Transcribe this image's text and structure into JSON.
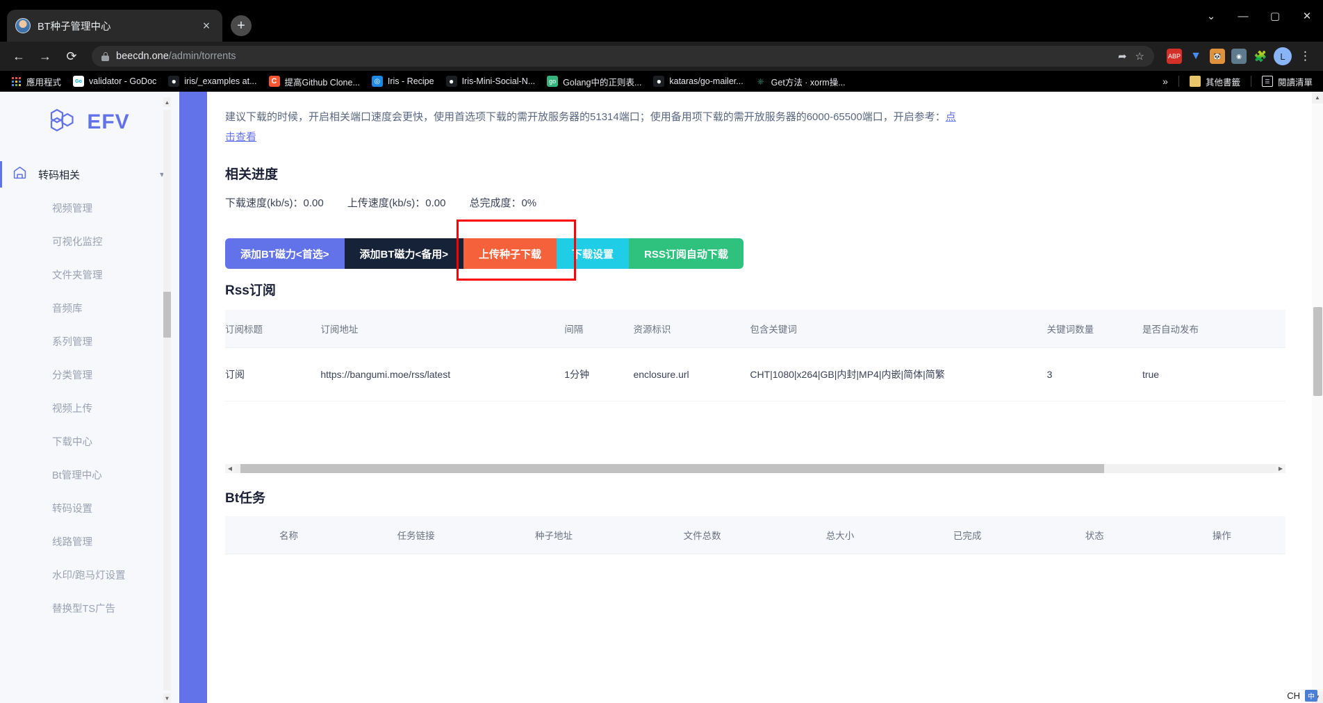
{
  "browser": {
    "tab": {
      "title": "BT种子管理中心",
      "favicon": "user-avatar-favicon",
      "close": "×"
    },
    "new_tab": "+",
    "window_controls": {
      "minimize_all": "⌄",
      "minimize": "—",
      "maximize": "▢",
      "close": "✕"
    },
    "nav": {
      "back": "←",
      "forward": "→",
      "reload": "⟳"
    },
    "omnibox": {
      "domain": "beecdn.one",
      "path": "/admin/torrents",
      "share_icon": "share-icon",
      "bookmark_icon": "star-icon"
    },
    "extensions": [
      {
        "name": "adblock-plus",
        "label": "ABP",
        "color": "#d4302a"
      },
      {
        "name": "vue-devtools",
        "label": "V",
        "color": "#41b883"
      },
      {
        "name": "tampermonkey",
        "label": "TM",
        "color": "#e0913b"
      },
      {
        "name": "proxy-switchy",
        "label": "P",
        "color": "#5e7a8c"
      },
      {
        "name": "puzzle-extensions",
        "label": "🧩",
        "color": "#3c4043"
      }
    ],
    "profile": "L",
    "menu": "⋮",
    "bookmarks": [
      {
        "label": "應用程式",
        "icon": "apps-grid-icon",
        "color": ""
      },
      {
        "label": "validator - GoDoc",
        "icon": "godoc-icon",
        "color": "#ffffff"
      },
      {
        "label": "iris/_examples at...",
        "icon": "github-icon",
        "color": "#1b1f23"
      },
      {
        "label": "提高Github Clone...",
        "icon": "csdn-icon",
        "color": "#fc5531"
      },
      {
        "label": "Iris - Recipe",
        "icon": "iris-icon",
        "color": "#1e88e5"
      },
      {
        "label": "Iris-Mini-Social-N...",
        "icon": "github-icon",
        "color": "#1b1f23"
      },
      {
        "label": "Golang中的正则表...",
        "icon": "go-icon",
        "color": "#35b37e"
      },
      {
        "label": "kataras/go-mailer...",
        "icon": "github-icon",
        "color": "#1b1f23"
      },
      {
        "label": "Get方法 · xorm操...",
        "icon": "gitbook-icon",
        "color": "#3b8070"
      }
    ],
    "bookmarks_overflow": "»",
    "other_bookmarks": {
      "label": "其他書籤",
      "icon": "folder-icon"
    },
    "reading_list": {
      "label": "閱讀清單",
      "icon": "reading-list-icon"
    }
  },
  "sidebar": {
    "brand": {
      "text": "EFV",
      "logo": "hexagon-logo-icon"
    },
    "group": {
      "label": "转码相关",
      "icon": "home-icon",
      "chevron": "chevron-down-icon"
    },
    "items": [
      {
        "label": "视频管理"
      },
      {
        "label": "可视化监控"
      },
      {
        "label": "文件夹管理"
      },
      {
        "label": "音频库"
      },
      {
        "label": "系列管理"
      },
      {
        "label": "分类管理"
      },
      {
        "label": "视频上传"
      },
      {
        "label": "下载中心"
      },
      {
        "label": "Bt管理中心"
      },
      {
        "label": "转码设置"
      },
      {
        "label": "线路管理"
      },
      {
        "label": "水印/跑马灯设置"
      },
      {
        "label": "替换型TS广告"
      }
    ]
  },
  "main": {
    "notice_line1": "建议下载的时候，开启相关端口速度会更快，使用首选项下载的需开放服务器的51314端口；使用备用项下载的需开放服务器的6000-65500端口，开启参考：",
    "notice_link1": "点",
    "notice_link2": "击查看",
    "progress_title": "相关进度",
    "progress": {
      "download_speed_label": "下载速度(kb/s)：",
      "download_speed_value": "0.00",
      "upload_speed_label": "上传速度(kb/s)：",
      "upload_speed_value": "0.00",
      "total_label": "总完成度：",
      "total_value": "0%"
    },
    "buttons": [
      {
        "label": "添加BT磁力<首选>",
        "color": "#6272e8",
        "name": "add-bt-magnet-primary-button"
      },
      {
        "label": "添加BT磁力<备用>",
        "color": "#152238",
        "name": "add-bt-magnet-backup-button"
      },
      {
        "label": "上传种子下载",
        "color": "#f4613a",
        "name": "upload-torrent-download-button"
      },
      {
        "label": "下载设置",
        "color": "#1fcde6",
        "name": "download-settings-button"
      },
      {
        "label": "RSS订阅自动下载",
        "color": "#2ec27e",
        "name": "rss-auto-download-button"
      }
    ],
    "highlight_color": "#ff0000",
    "rss_section_title": "Rss订阅",
    "rss_table": {
      "headers": [
        "订阅标题",
        "订阅地址",
        "间隔",
        "资源标识",
        "包含关键词",
        "关键词数量",
        "是否自动发布",
        ""
      ],
      "rows": [
        {
          "title": "订阅",
          "url": "https://bangumi.moe/rss/latest",
          "interval": "1分钟",
          "resource_id": "enclosure.url",
          "keywords": "CHT|1080|x264|GB|内封|MP4|内嵌|简体|简繁",
          "keyword_count": "3",
          "auto_publish": "true",
          "extra": ""
        }
      ]
    },
    "bt_section_title": "Bt任务",
    "bt_table": {
      "headers": [
        "名称",
        "任务链接",
        "种子地址",
        "文件总数",
        "总大小",
        "已完成",
        "状态",
        "操作"
      ],
      "rows": []
    }
  },
  "ime": {
    "lang": "CH",
    "badge": "中"
  }
}
